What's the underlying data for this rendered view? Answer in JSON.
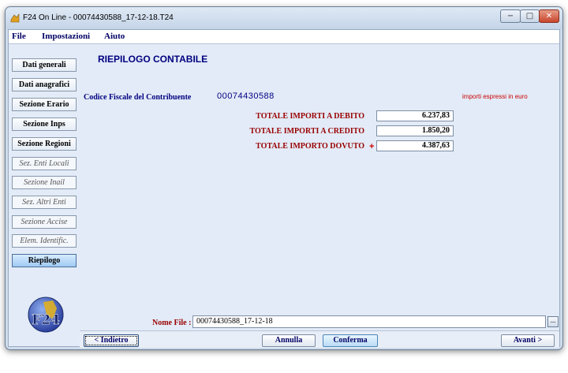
{
  "window": {
    "title": "F24 On Line - 00074430588_17-12-18.T24",
    "min_glyph": "−",
    "max_glyph": "□",
    "close_glyph": "✕"
  },
  "menu": {
    "file": "File",
    "impostazioni": "Impostazioni",
    "aiuto": "Aiuto"
  },
  "sidebar": {
    "items": [
      {
        "label": "Dati generali"
      },
      {
        "label": "Dati anagrafici"
      },
      {
        "label": "Sezione Erario"
      },
      {
        "label": "Sezione Inps"
      },
      {
        "label": "Sezione Regioni"
      },
      {
        "label": "Sez. Enti Locali"
      },
      {
        "label": "Sezione Inail"
      },
      {
        "label": "Sez. Altri Enti"
      },
      {
        "label": "Sezione Accise"
      },
      {
        "label": "Elem. Identific."
      },
      {
        "label": "Riepilogo"
      }
    ]
  },
  "main": {
    "heading": "RIEPILOGO CONTABILE",
    "cf_label": "Codice Fiscale del Contribuente",
    "cf_value": "00074430588",
    "euro_note": "importi espressi in euro",
    "totals": [
      {
        "label": "TOTALE IMPORTI A DEBITO",
        "value": "6.237,83"
      },
      {
        "label": "TOTALE IMPORTI A CREDITO",
        "value": "1.850,20"
      },
      {
        "label": "TOTALE IMPORTO DOVUTO",
        "value": "4.387,63"
      }
    ],
    "plus_sign": "+"
  },
  "logo_text": "F24",
  "file": {
    "label": "Nome File :",
    "value": "00074430588_17-12-18",
    "browse": "..."
  },
  "buttons": {
    "back": "< Indietro",
    "cancel": "Annulla",
    "confirm": "Conferma",
    "next": "Avanti >"
  },
  "colors": {
    "accent": "#000080",
    "total_label": "#990000",
    "note": "#cc0000"
  }
}
